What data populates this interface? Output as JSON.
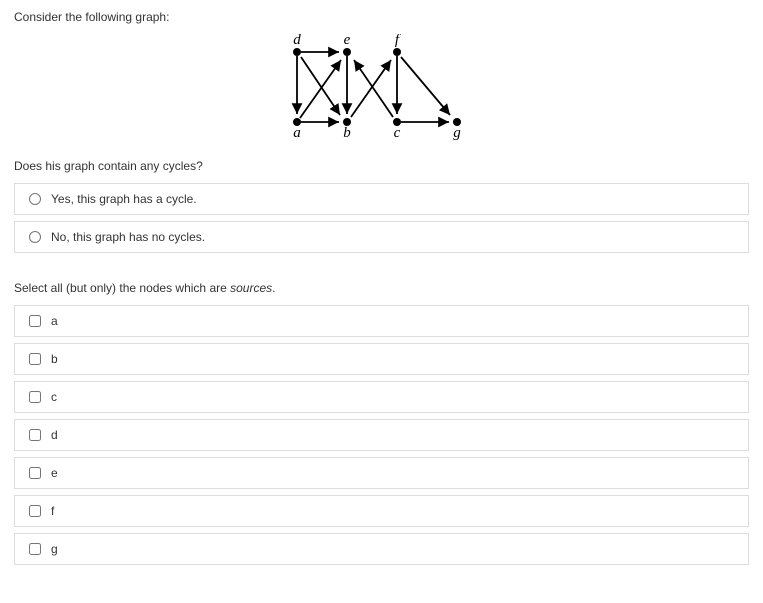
{
  "q1": {
    "prompt": "Consider the following graph:",
    "followup": "Does his graph contain any cycles?",
    "options": [
      "Yes, this graph has a cycle.",
      "No, this graph has no cycles."
    ]
  },
  "q2": {
    "prompt_prefix": "Select all (but only) the nodes which are ",
    "prompt_italic": "sources",
    "prompt_suffix": ".",
    "options": [
      "a",
      "b",
      "c",
      "d",
      "e",
      "f",
      "g"
    ]
  },
  "graph": {
    "nodes": {
      "a": "a",
      "b": "b",
      "c": "c",
      "d": "d",
      "e": "e",
      "f": "f",
      "g": "g"
    }
  }
}
